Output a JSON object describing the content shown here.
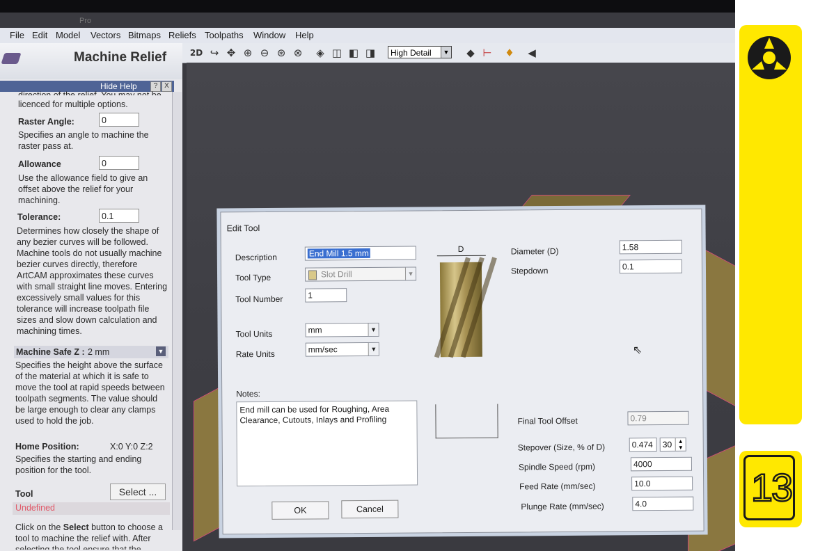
{
  "app": {
    "title_fragment": "Pro"
  },
  "menubar": [
    "File",
    "Edit",
    "Model",
    "Vectors",
    "Bitmaps",
    "Reliefs",
    "Toolpaths",
    "Window",
    "Help"
  ],
  "toolbar": {
    "view_2d": "2D",
    "detail": "High Detail"
  },
  "panel": {
    "title": "Machine Relief",
    "hide_help": "Hide Help",
    "help_btn": "?",
    "close_btn": "X",
    "intro_top": "direction of the relief. You may not be",
    "intro": "licenced for multiple options.",
    "raster_angle": {
      "label": "Raster Angle:",
      "value": "0",
      "help": "Specifies an angle to machine the raster pass at."
    },
    "allowance": {
      "label": "Allowance",
      "value": "0",
      "help": "Use the allowance field to give an offset above the relief for your machining."
    },
    "tolerance": {
      "label": "Tolerance:",
      "value": "0.1",
      "help": "Determines how closely the shape of any bezier curves will be followed. Machine tools do not usually machine bezier curves directly, therefore ArtCAM approximates these curves with small straight line moves. Entering excessively small values for this tolerance will increase toolpath file sizes and slow down calculation and machining times."
    },
    "safe_z": {
      "label": "Machine Safe Z :",
      "value": "2 mm",
      "help": "Specifies the height above the surface of the material at which it is safe to move the tool at rapid speeds between toolpath segments. The value should be large enough to clear any clamps used to hold the job."
    },
    "home": {
      "label": "Home Position:",
      "value": "X:0 Y:0 Z:2",
      "help": "Specifies the starting and ending position for the tool."
    },
    "tool": {
      "label": "Tool",
      "select_btn": "Select ...",
      "status": "Undefined",
      "status_color": "#e05a6a"
    },
    "footer_help_1": "Click on the ",
    "footer_help_bold": "Select",
    "footer_help_2": " button to choose a tool to machine the relief with. After selecting the tool ensure that the"
  },
  "dialog": {
    "title": "Edit Tool",
    "description": {
      "label": "Description",
      "value": "End Mill 1.5 mm"
    },
    "tool_type": {
      "label": "Tool Type",
      "value": "Slot Drill"
    },
    "tool_number": {
      "label": "Tool Number",
      "value": "1"
    },
    "tool_units": {
      "label": "Tool Units",
      "value": "mm"
    },
    "rate_units": {
      "label": "Rate Units",
      "value": "mm/sec"
    },
    "diagram_label": "D",
    "diameter": {
      "label": "Diameter (D)",
      "value": "1.58"
    },
    "stepdown": {
      "label": "Stepdown",
      "value": "0.1"
    },
    "notes": {
      "label": "Notes:",
      "value": "End mill can be used for Roughing, Area Clearance, Cutouts, Inlays and Profiling"
    },
    "final_offset": {
      "label": "Final Tool Offset",
      "value": "0.79"
    },
    "stepover": {
      "label": "Stepover (Size, % of D)",
      "value": "0.474",
      "percent": "30"
    },
    "spindle": {
      "label": "Spindle Speed (rpm)",
      "value": "4000"
    },
    "feed": {
      "label": "Feed Rate (mm/sec)",
      "value": "10.0"
    },
    "plunge": {
      "label": "Plunge Rate (mm/sec)",
      "value": "4.0"
    },
    "ok": "OK",
    "cancel": "Cancel"
  },
  "sidebar": {
    "accent": "#ffe800",
    "page_number": "13",
    "logo_icon": "fusion-logo-icon"
  }
}
